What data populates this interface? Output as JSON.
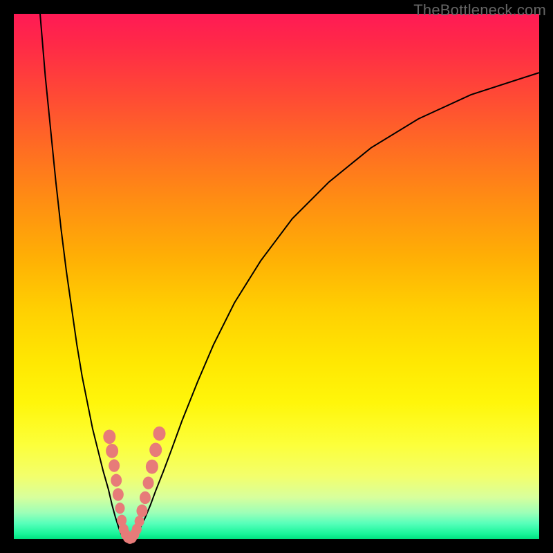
{
  "watermark": "TheBottleneck.com",
  "colors": {
    "frame": "#000000",
    "curve": "#000000",
    "dot_fill": "#e77b79",
    "dot_stroke": "#d65f5d"
  },
  "chart_data": {
    "type": "line",
    "title": "",
    "xlabel": "",
    "ylabel": "",
    "xlim": [
      0,
      100
    ],
    "ylim": [
      0,
      100
    ],
    "grid": false,
    "series": [
      {
        "name": "left-branch",
        "x": [
          5,
          6,
          7,
          8,
          9,
          10,
          11,
          12,
          13,
          14,
          15,
          16,
          17,
          18,
          18.7,
          19.3,
          19.8,
          20.2,
          20.6
        ],
        "y": [
          100,
          88,
          78,
          68,
          59,
          51,
          44,
          37,
          31,
          26,
          21,
          17,
          13,
          9.5,
          6.5,
          4.3,
          2.7,
          1.5,
          0.7
        ]
      },
      {
        "name": "valley",
        "x": [
          20.6,
          21,
          21.4,
          21.8,
          22.2,
          22.6,
          23,
          23.5,
          24
        ],
        "y": [
          0.7,
          0.3,
          0.1,
          0,
          0.05,
          0.2,
          0.5,
          1.1,
          2
        ]
      },
      {
        "name": "right-branch",
        "x": [
          24,
          25,
          26,
          27,
          28.5,
          30,
          32,
          35,
          38,
          42,
          47,
          53,
          60,
          68,
          77,
          87,
          100
        ],
        "y": [
          2,
          4.1,
          6.5,
          9.2,
          13,
          17,
          22.5,
          30,
          37,
          45,
          53,
          61,
          68,
          74.5,
          80,
          84.6,
          88.8
        ]
      }
    ],
    "scatter": {
      "name": "highlight-dots",
      "points": [
        {
          "x": 18.2,
          "y": 19.5,
          "r": 9
        },
        {
          "x": 18.7,
          "y": 16.8,
          "r": 9
        },
        {
          "x": 19.1,
          "y": 14.0,
          "r": 8
        },
        {
          "x": 19.5,
          "y": 11.2,
          "r": 8
        },
        {
          "x": 19.85,
          "y": 8.5,
          "r": 8
        },
        {
          "x": 20.2,
          "y": 5.9,
          "r": 7
        },
        {
          "x": 20.55,
          "y": 3.6,
          "r": 7
        },
        {
          "x": 20.9,
          "y": 1.9,
          "r": 7
        },
        {
          "x": 21.3,
          "y": 0.9,
          "r": 7
        },
        {
          "x": 21.7,
          "y": 0.35,
          "r": 7
        },
        {
          "x": 22.1,
          "y": 0.15,
          "r": 7
        },
        {
          "x": 22.5,
          "y": 0.3,
          "r": 7
        },
        {
          "x": 22.95,
          "y": 0.9,
          "r": 7
        },
        {
          "x": 23.4,
          "y": 1.9,
          "r": 7
        },
        {
          "x": 23.9,
          "y": 3.4,
          "r": 7
        },
        {
          "x": 24.4,
          "y": 5.4,
          "r": 8
        },
        {
          "x": 25.0,
          "y": 7.9,
          "r": 8
        },
        {
          "x": 25.6,
          "y": 10.7,
          "r": 8
        },
        {
          "x": 26.3,
          "y": 13.8,
          "r": 9
        },
        {
          "x": 27.0,
          "y": 17.0,
          "r": 9
        },
        {
          "x": 27.7,
          "y": 20.1,
          "r": 9
        }
      ]
    }
  }
}
